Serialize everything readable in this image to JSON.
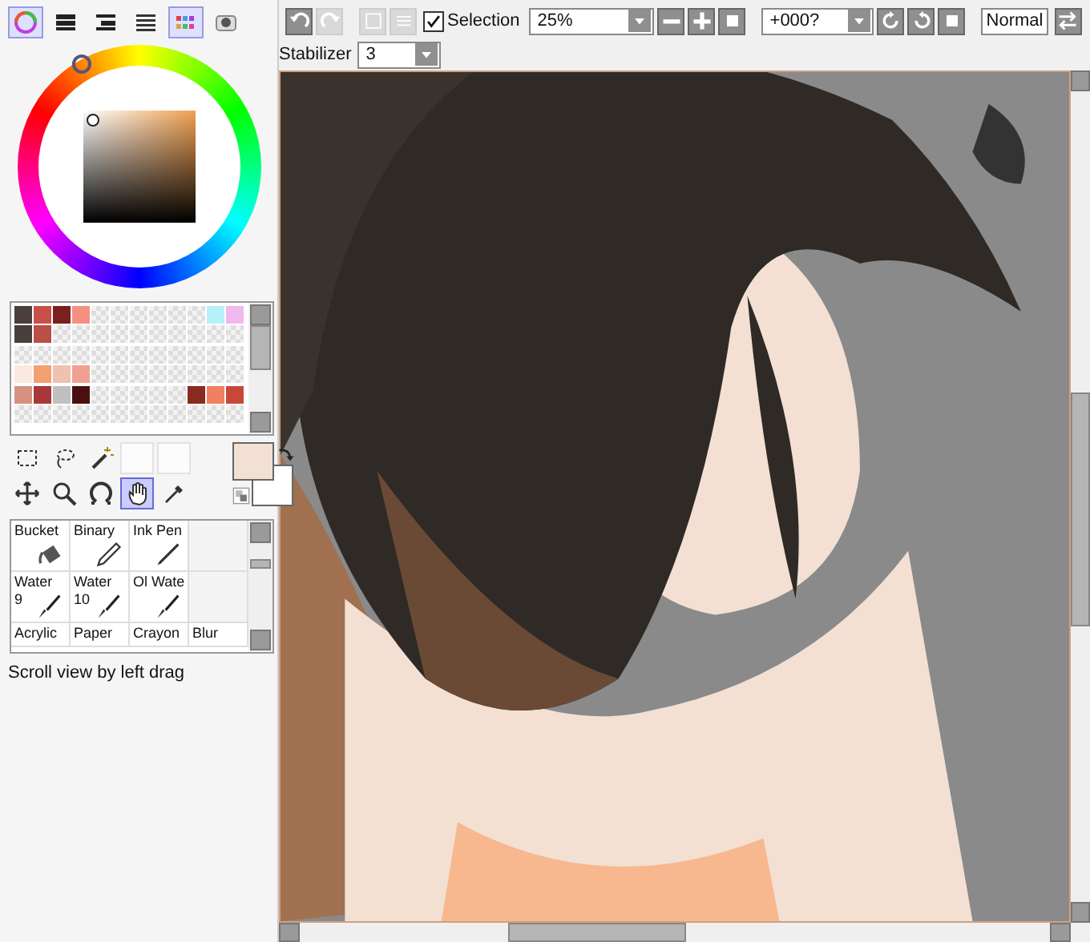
{
  "panel_tabs": [
    {
      "kind": "wheel",
      "on": true
    },
    {
      "kind": "sliders",
      "on": false
    },
    {
      "kind": "hsv",
      "on": false
    },
    {
      "kind": "bars",
      "on": false
    },
    {
      "kind": "palette",
      "on": true
    },
    {
      "kind": "scratch",
      "on": false
    }
  ],
  "swatches": [
    [
      {
        "kind": "color",
        "color": "#4a3f3c"
      },
      {
        "kind": "color",
        "color": "#c85048"
      },
      {
        "kind": "color",
        "color": "#7a2020"
      },
      {
        "kind": "color",
        "color": "#f59080"
      },
      {
        "kind": "empty"
      },
      {
        "kind": "empty"
      },
      {
        "kind": "empty"
      },
      {
        "kind": "empty"
      },
      {
        "kind": "empty"
      },
      {
        "kind": "empty"
      },
      {
        "kind": "color",
        "color": "#b8f0f8"
      },
      {
        "kind": "color",
        "color": "#f0b8f0"
      }
    ],
    [
      {
        "kind": "color",
        "color": "#4a3e3a"
      },
      {
        "kind": "color",
        "color": "#b85048"
      },
      {
        "kind": "empty"
      },
      {
        "kind": "empty"
      },
      {
        "kind": "empty"
      },
      {
        "kind": "empty"
      },
      {
        "kind": "empty"
      },
      {
        "kind": "empty"
      },
      {
        "kind": "empty"
      },
      {
        "kind": "empty"
      },
      {
        "kind": "empty"
      },
      {
        "kind": "empty"
      }
    ],
    [
      {
        "kind": "empty"
      },
      {
        "kind": "empty"
      },
      {
        "kind": "empty"
      },
      {
        "kind": "empty"
      },
      {
        "kind": "empty"
      },
      {
        "kind": "empty"
      },
      {
        "kind": "empty"
      },
      {
        "kind": "empty"
      },
      {
        "kind": "empty"
      },
      {
        "kind": "empty"
      },
      {
        "kind": "empty"
      },
      {
        "kind": "empty"
      }
    ],
    [
      {
        "kind": "color",
        "color": "#fbe8e0"
      },
      {
        "kind": "color",
        "color": "#f5a070"
      },
      {
        "kind": "color",
        "color": "#f0c0b0"
      },
      {
        "kind": "color",
        "color": "#f0a090"
      },
      {
        "kind": "empty"
      },
      {
        "kind": "empty"
      },
      {
        "kind": "empty"
      },
      {
        "kind": "empty"
      },
      {
        "kind": "empty"
      },
      {
        "kind": "empty"
      },
      {
        "kind": "empty"
      },
      {
        "kind": "empty"
      }
    ],
    [
      {
        "kind": "color",
        "color": "#d89080"
      },
      {
        "kind": "color",
        "color": "#a83838"
      },
      {
        "kind": "color",
        "color": "#c0c0c0"
      },
      {
        "kind": "color",
        "color": "#4a1010"
      },
      {
        "kind": "empty"
      },
      {
        "kind": "empty"
      },
      {
        "kind": "empty"
      },
      {
        "kind": "empty"
      },
      {
        "kind": "empty"
      },
      {
        "kind": "color",
        "color": "#8a2a20"
      },
      {
        "kind": "color",
        "color": "#f08060"
      },
      {
        "kind": "color",
        "color": "#c84838"
      }
    ],
    [
      {
        "kind": "empty"
      },
      {
        "kind": "empty"
      },
      {
        "kind": "empty"
      },
      {
        "kind": "empty"
      },
      {
        "kind": "empty"
      },
      {
        "kind": "empty"
      },
      {
        "kind": "empty"
      },
      {
        "kind": "empty"
      },
      {
        "kind": "empty"
      },
      {
        "kind": "empty"
      },
      {
        "kind": "empty"
      },
      {
        "kind": "empty"
      }
    ]
  ],
  "tools": [
    {
      "kind": "select",
      "selected": false
    },
    {
      "kind": "lasso",
      "selected": false
    },
    {
      "kind": "wand",
      "selected": false
    },
    {
      "kind": "empty"
    },
    {
      "kind": "empty"
    },
    {
      "kind": "move",
      "selected": false
    },
    {
      "kind": "zoom",
      "selected": false
    },
    {
      "kind": "rotate",
      "selected": false
    },
    {
      "kind": "hand",
      "selected": true
    },
    {
      "kind": "dropper",
      "selected": false
    }
  ],
  "primary_color": {
    "color": "#f2e0d4"
  },
  "secondary_color": {
    "color": "#ffffff"
  },
  "brushes": [
    {
      "name": "Bucket",
      "kind": "bucket"
    },
    {
      "name": "Binary",
      "kind": "pencil"
    },
    {
      "name": "Ink Pen",
      "kind": "pen"
    },
    {
      "kind": "empty"
    },
    {
      "name": "Water",
      "size": "9",
      "kind": "brush"
    },
    {
      "name": "Water",
      "size": "10",
      "kind": "brush"
    },
    {
      "name": "Ol Wate",
      "kind": "brush"
    },
    {
      "kind": "empty"
    },
    {
      "name": "Acrylic",
      "kind": "none"
    },
    {
      "name": "Paper",
      "kind": "none"
    },
    {
      "name": "Crayon",
      "kind": "none"
    },
    {
      "name": "Blur",
      "kind": "none"
    }
  ],
  "status": "Scroll view by left drag",
  "toolbar": {
    "undo_disabled": false,
    "redo_disabled": true,
    "selection_label": "Selection",
    "selection_checked": true,
    "zoom": "25%",
    "rotation": "+000?",
    "blend": "Normal",
    "stabilizer_label": "Stabilizer",
    "stabilizer": "3"
  }
}
